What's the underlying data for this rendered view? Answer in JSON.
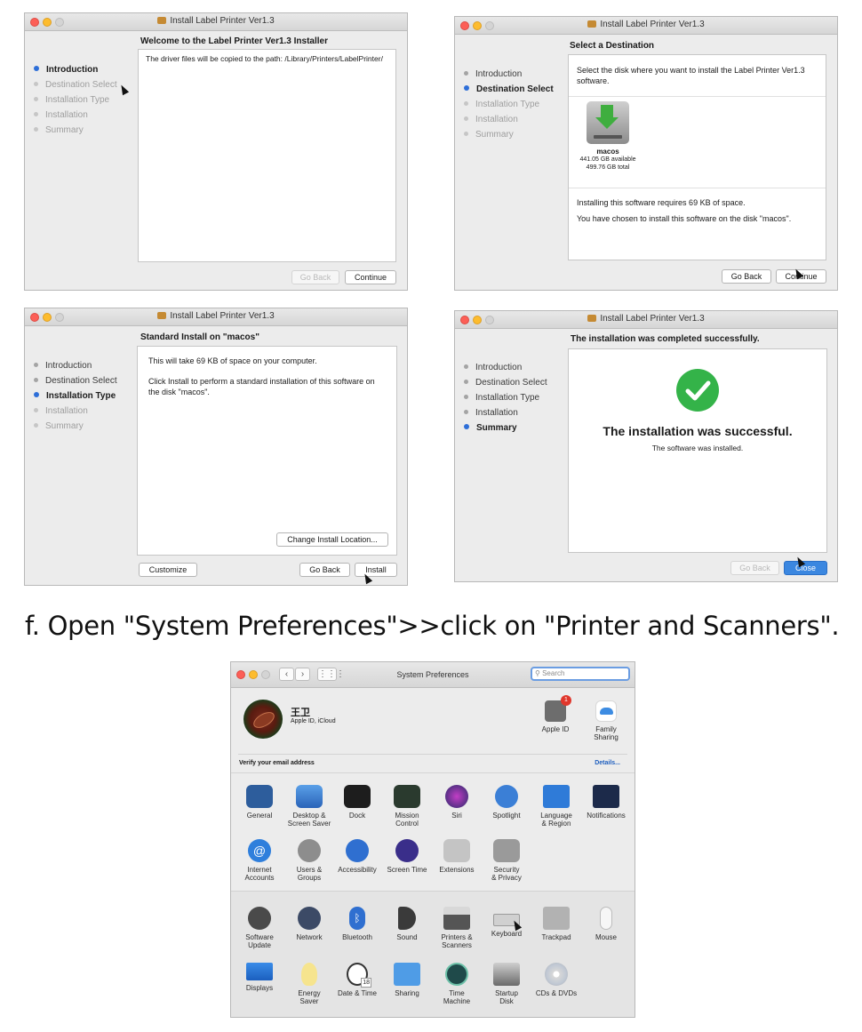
{
  "installer": {
    "window_title": "Install Label Printer Ver1.3",
    "steps": [
      "Introduction",
      "Destination Select",
      "Installation Type",
      "Installation",
      "Summary"
    ],
    "buttons": {
      "go_back": "Go Back",
      "continue": "Continue",
      "install": "Install",
      "close": "Close",
      "customize": "Customize",
      "change_location": "Change Install Location..."
    }
  },
  "win1": {
    "heading": "Welcome to the Label Printer Ver1.3 Installer",
    "body": "The driver files will be copied to the path: /Library/Printers/LabelPrinter/"
  },
  "win2": {
    "heading": "Select a Destination",
    "prompt": "Select the disk where you want to install the Label Printer Ver1.3 software.",
    "disk_name": "macos",
    "disk_available": "441.05 GB available",
    "disk_total": "499.76 GB total",
    "requires": "Installing this software requires 69 KB of space.",
    "chosen": "You have chosen to install this software on the disk \"macos\"."
  },
  "win3": {
    "heading": "Standard Install on \"macos\"",
    "space": "This will take 69 KB of space on your computer.",
    "instruction": "Click Install to perform a standard installation of this software on the disk \"macos\"."
  },
  "win4": {
    "heading": "The installation was completed successfully.",
    "success_title": "The installation was successful.",
    "success_sub": "The software was installed."
  },
  "caption": "f. Open \"System Preferences\">>click on \"Printer and Scanners\".",
  "sysprefs": {
    "title": "System Preferences",
    "search_placeholder": "Search",
    "user_name": "王卫",
    "user_sub": "Apple ID, iCloud",
    "apple_id_label": "Apple ID",
    "apple_id_badge": "1",
    "family_label": "Family\nSharing",
    "verify_text": "Verify your email address",
    "details_link": "Details...",
    "row1": [
      "General",
      "Desktop &\nScreen Saver",
      "Dock",
      "Mission\nControl",
      "Siri",
      "Spotlight",
      "Language\n& Region",
      "Notifications"
    ],
    "row2": [
      "Internet\nAccounts",
      "Users &\nGroups",
      "Accessibility",
      "Screen Time",
      "Extensions",
      "Security\n& Privacy"
    ],
    "row3": [
      "Software\nUpdate",
      "Network",
      "Bluetooth",
      "Sound",
      "Printers &\nScanners",
      "Keyboard",
      "Trackpad",
      "Mouse"
    ],
    "row4": [
      "Displays",
      "Energy\nSaver",
      "Date & Time",
      "Sharing",
      "Time\nMachine",
      "Startup\nDisk",
      "CDs & DVDs"
    ],
    "date_icon_text": "18"
  },
  "colors": {
    "accent_blue": "#2e6fd8",
    "success_green": "#34b349",
    "primary_button": "#3b87e0"
  }
}
